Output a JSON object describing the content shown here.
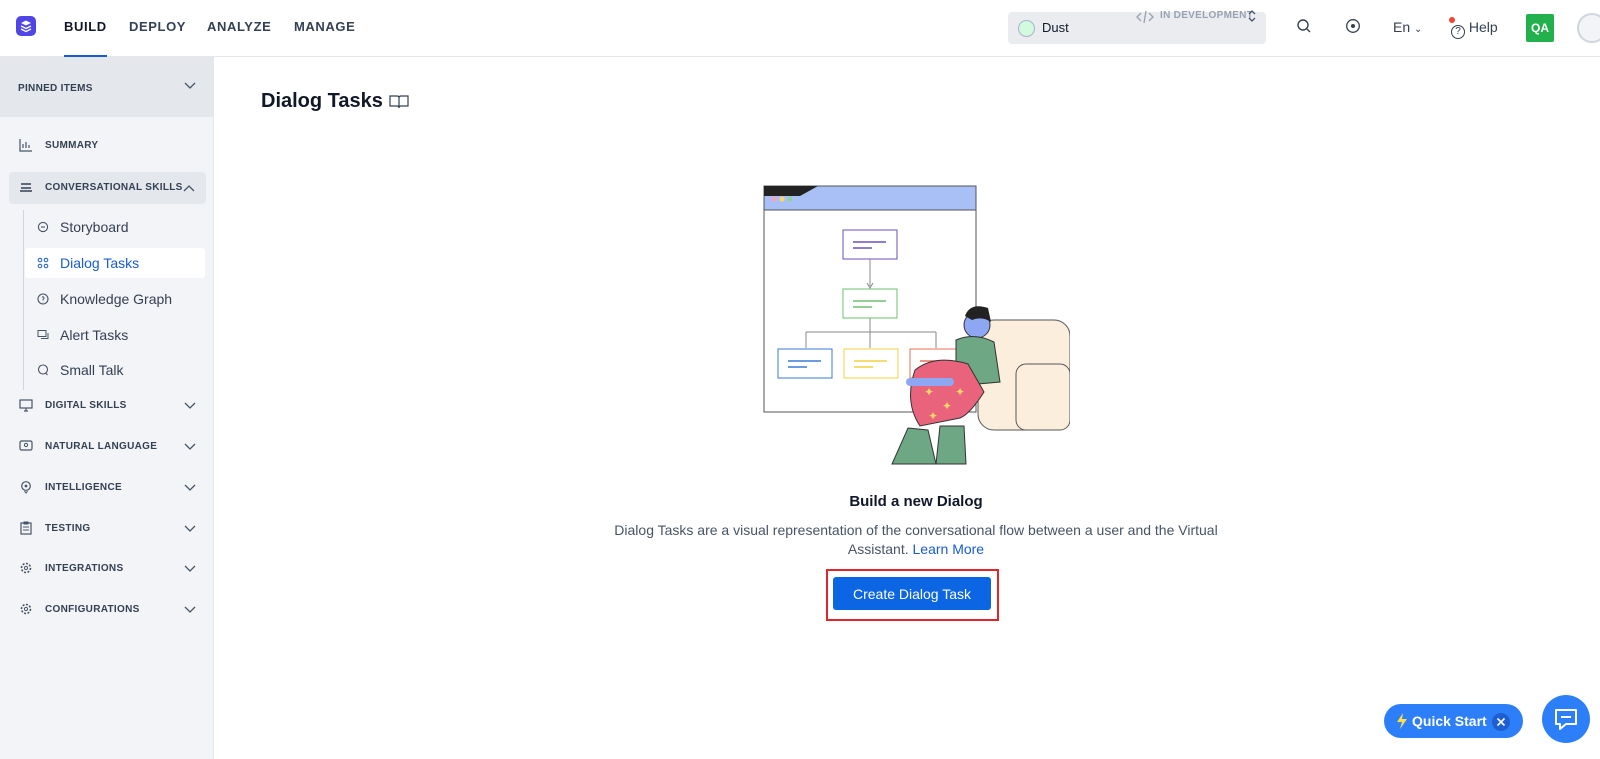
{
  "nav": {
    "tabs": [
      {
        "label": "BUILD",
        "active": true
      },
      {
        "label": "DEPLOY",
        "active": false
      },
      {
        "label": "ANALYZE",
        "active": false
      },
      {
        "label": "MANAGE",
        "active": false
      }
    ]
  },
  "bot": {
    "name": "Dust",
    "status": "IN DEVELOPMENT"
  },
  "header": {
    "language": "En",
    "help_label": "Help",
    "user_initials": "QA"
  },
  "sidebar": {
    "pinned_label": "PINNED ITEMS",
    "items": [
      {
        "label": "SUMMARY",
        "icon": "bar-chart-icon"
      },
      {
        "label": "CONVERSATIONAL SKILLS",
        "icon": "layers-icon",
        "expanded": true
      },
      {
        "label": "DIGITAL SKILLS",
        "icon": "monitor-icon"
      },
      {
        "label": "NATURAL LANGUAGE",
        "icon": "speech-icon"
      },
      {
        "label": "INTELLIGENCE",
        "icon": "bulb-icon"
      },
      {
        "label": "TESTING",
        "icon": "clipboard-icon"
      },
      {
        "label": "INTEGRATIONS",
        "icon": "gear-icon"
      },
      {
        "label": "CONFIGURATIONS",
        "icon": "settings-icon"
      }
    ],
    "sub_items": [
      {
        "label": "Storyboard",
        "icon": "storyboard-icon"
      },
      {
        "label": "Dialog Tasks",
        "icon": "dialog-tasks-icon",
        "active": true
      },
      {
        "label": "Knowledge Graph",
        "icon": "knowledge-graph-icon"
      },
      {
        "label": "Alert Tasks",
        "icon": "alert-tasks-icon"
      },
      {
        "label": "Small Talk",
        "icon": "small-talk-icon"
      }
    ]
  },
  "main": {
    "title": "Dialog Tasks",
    "empty_title": "Build a new Dialog",
    "empty_description": "Dialog Tasks are a visual representation of the conversational flow between a user and the Virtual Assistant.",
    "learn_more": "Learn More",
    "create_button": "Create Dialog Task"
  },
  "quick_start": {
    "label": "Quick Start"
  },
  "colors": {
    "accent": "#0c66e4",
    "active_link": "#175cd3",
    "highlight": "#e0262d",
    "user_badge": "#22b14c"
  }
}
